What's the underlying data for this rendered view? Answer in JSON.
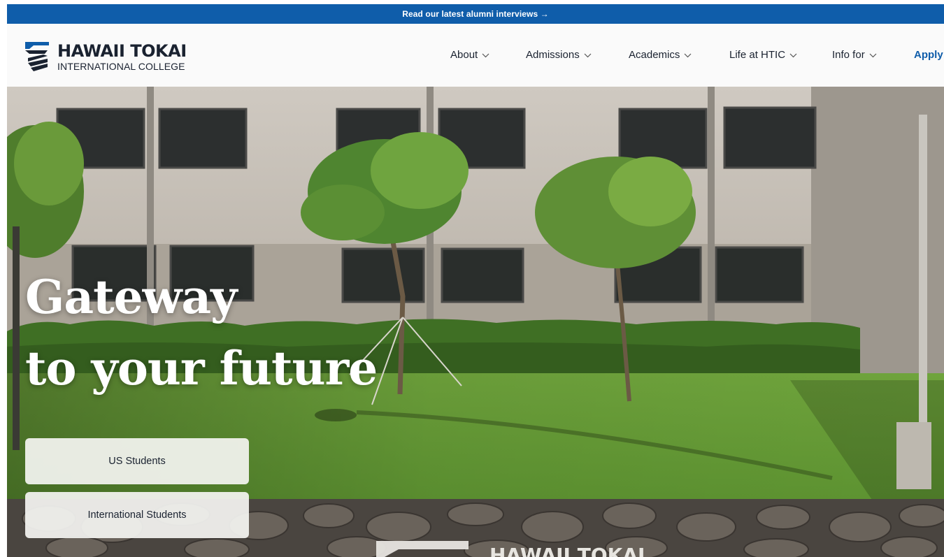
{
  "announcement": {
    "text": "Read our latest alumni interviews →"
  },
  "brand": {
    "line1": "HAWAII TOKAI",
    "line2": "INTERNATIONAL COLLEGE"
  },
  "nav": {
    "items": [
      {
        "label": "About"
      },
      {
        "label": "Admissions"
      },
      {
        "label": "Academics"
      },
      {
        "label": "Life at HTIC"
      },
      {
        "label": "Info for"
      }
    ],
    "apply": "Apply"
  },
  "hero": {
    "title_line1": "Gateway",
    "title_line2": "to your future",
    "ctas": [
      {
        "label": "US Students"
      },
      {
        "label": "International Students"
      }
    ],
    "watermark": "HAWAII TOKAI"
  },
  "colors": {
    "accent": "#0f5daa",
    "text": "#1a2230"
  },
  "icons": {
    "logo": "hawaii-tokai-logo-mark",
    "nav_chevron": "chevron-down-icon"
  }
}
